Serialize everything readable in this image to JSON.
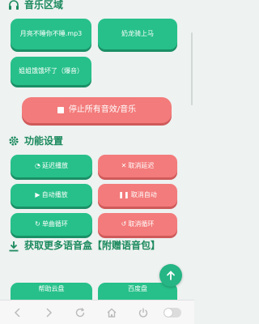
{
  "music_section": {
    "title": "音乐区域",
    "icon": "headphones-icon",
    "tracks": [
      {
        "label": "月亮不睡你不睡.mp3"
      },
      {
        "label": "奶龙骑上马"
      },
      {
        "label": "姐姐饿饿坏了（爆音）"
      }
    ],
    "stop_label": "停止所有音效/音乐"
  },
  "settings_section": {
    "title": "功能设置",
    "icon": "gear-icon",
    "buttons": [
      {
        "label": "延迟播放",
        "icon": "clock-icon"
      },
      {
        "label": "取消延迟",
        "icon": "close-icon"
      },
      {
        "label": "自动播放",
        "icon": "play-icon"
      },
      {
        "label": "取消自动",
        "icon": "pause-icon"
      },
      {
        "label": "单曲循环",
        "icon": "repeat-icon"
      },
      {
        "label": "取消循环",
        "icon": "undo-icon"
      }
    ]
  },
  "more_section": {
    "title": "获取更多语音盒【附赠语音包】",
    "icon": "download-icon",
    "partial_buttons": [
      {
        "label": "帮助云盘"
      },
      {
        "label": "百度盘"
      }
    ]
  },
  "colors": {
    "accent_green": "#27c08a",
    "danger_red": "#f37b7b",
    "title_green": "#1c8a5e"
  }
}
